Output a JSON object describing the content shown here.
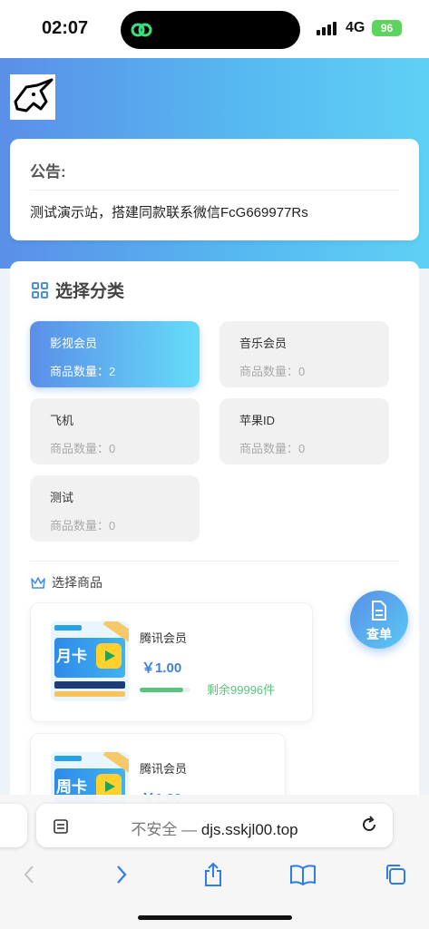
{
  "status_bar": {
    "time": "02:07",
    "network": "4G",
    "battery": "96"
  },
  "notice": {
    "title": "公告:",
    "text": "测试演示站，搭建同款联系微信FcG669977Rs"
  },
  "categories": {
    "title": "选择分类",
    "items": [
      {
        "name": "影视会员",
        "count": "商品数量：2"
      },
      {
        "name": "音乐会员",
        "count": "商品数量：0"
      },
      {
        "name": "飞机",
        "count": "商品数量：0"
      },
      {
        "name": "苹果ID",
        "count": "商品数量：0"
      },
      {
        "name": "测试",
        "count": "商品数量：0"
      }
    ]
  },
  "products": {
    "title": "选择商品",
    "items": [
      {
        "name": "腾讯会员",
        "price": "￥1.00",
        "stock": "剩余99996件",
        "thumb_label": "月卡",
        "stock_fraction": 0.85
      },
      {
        "name": "腾讯会员",
        "price": "￥1.00",
        "thumb_label": "周卡"
      }
    ]
  },
  "float_button": {
    "label": "查单"
  },
  "browser": {
    "insecure": "不安全",
    "separator": " — ",
    "domain": "djs.sskjl00.top"
  },
  "colors": {
    "accent": "#5a8fe8",
    "accent_light": "#66dcf8",
    "price": "#3f7fe3",
    "stock": "#5ac37e"
  }
}
